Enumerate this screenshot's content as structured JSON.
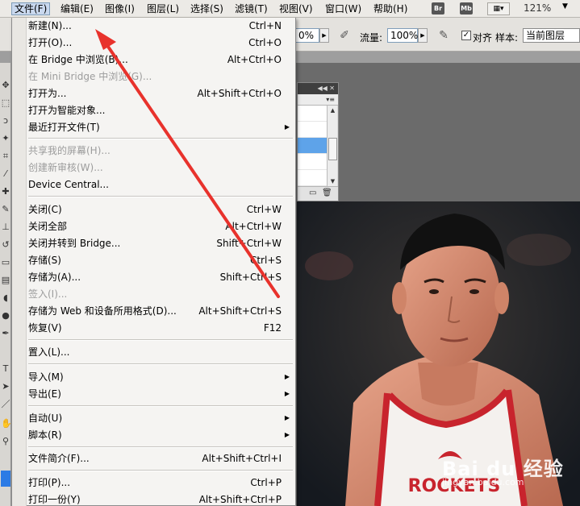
{
  "menubar": {
    "items": [
      "文件(F)",
      "编辑(E)",
      "图像(I)",
      "图层(L)",
      "选择(S)",
      "滤镜(T)",
      "视图(V)",
      "窗口(W)",
      "帮助(H)"
    ],
    "br_label": "Br",
    "mb_label": "Mb",
    "zoom": "121%"
  },
  "options": {
    "opacity_value": "0%",
    "flow_label": "流量:",
    "flow_value": "100%",
    "align_label": "对齐",
    "align_checked": true,
    "sample_label": "样本:",
    "sample_value": "当前图层"
  },
  "file_menu": {
    "items": [
      {
        "label": "新建(N)...",
        "shortcut": "Ctrl+N",
        "disabled": false
      },
      {
        "label": "打开(O)...",
        "shortcut": "Ctrl+O",
        "disabled": false
      },
      {
        "label": "在 Bridge 中浏览(B)...",
        "shortcut": "Alt+Ctrl+O",
        "disabled": false
      },
      {
        "label": "在 Mini Bridge 中浏览(G)...",
        "shortcut": "",
        "disabled": true
      },
      {
        "label": "打开为...",
        "shortcut": "Alt+Shift+Ctrl+O",
        "disabled": false
      },
      {
        "label": "打开为智能对象...",
        "shortcut": "",
        "disabled": false
      },
      {
        "label": "最近打开文件(T)",
        "shortcut": "",
        "disabled": false,
        "submenu": true
      },
      {
        "label": "共享我的屏幕(H)...",
        "shortcut": "",
        "disabled": true
      },
      {
        "label": "创建新审核(W)...",
        "shortcut": "",
        "disabled": true
      },
      {
        "label": "Device Central...",
        "shortcut": "",
        "disabled": false
      },
      {
        "label": "关闭(C)",
        "shortcut": "Ctrl+W",
        "disabled": false
      },
      {
        "label": "关闭全部",
        "shortcut": "Alt+Ctrl+W",
        "disabled": false
      },
      {
        "label": "关闭并转到 Bridge...",
        "shortcut": "Shift+Ctrl+W",
        "disabled": false
      },
      {
        "label": "存储(S)",
        "shortcut": "Ctrl+S",
        "disabled": false
      },
      {
        "label": "存储为(A)...",
        "shortcut": "Shift+Ctrl+S",
        "disabled": false
      },
      {
        "label": "签入(I)...",
        "shortcut": "",
        "disabled": true
      },
      {
        "label": "存储为 Web 和设备所用格式(D)...",
        "shortcut": "Alt+Shift+Ctrl+S",
        "disabled": false
      },
      {
        "label": "恢复(V)",
        "shortcut": "F12",
        "disabled": false
      },
      {
        "label": "置入(L)...",
        "shortcut": "",
        "disabled": false
      },
      {
        "label": "导入(M)",
        "shortcut": "",
        "disabled": false,
        "submenu": true
      },
      {
        "label": "导出(E)",
        "shortcut": "",
        "disabled": false,
        "submenu": true
      },
      {
        "label": "自动(U)",
        "shortcut": "",
        "disabled": false,
        "submenu": true
      },
      {
        "label": "脚本(R)",
        "shortcut": "",
        "disabled": false,
        "submenu": true
      },
      {
        "label": "文件简介(F)...",
        "shortcut": "Alt+Shift+Ctrl+I",
        "disabled": false
      },
      {
        "label": "打印(P)...",
        "shortcut": "Ctrl+P",
        "disabled": false
      },
      {
        "label": "打印一份(Y)",
        "shortcut": "Alt+Shift+Ctrl+P",
        "disabled": false
      }
    ]
  },
  "submenu_glyph": "▶",
  "watermark": {
    "main": "Bai du 经验",
    "sub": "jingyan.baidu.com"
  },
  "colors": {
    "annotation_arrow": "#e8322c",
    "menu_bg": "#f5f4f2",
    "selection": "#5ea3e9"
  }
}
